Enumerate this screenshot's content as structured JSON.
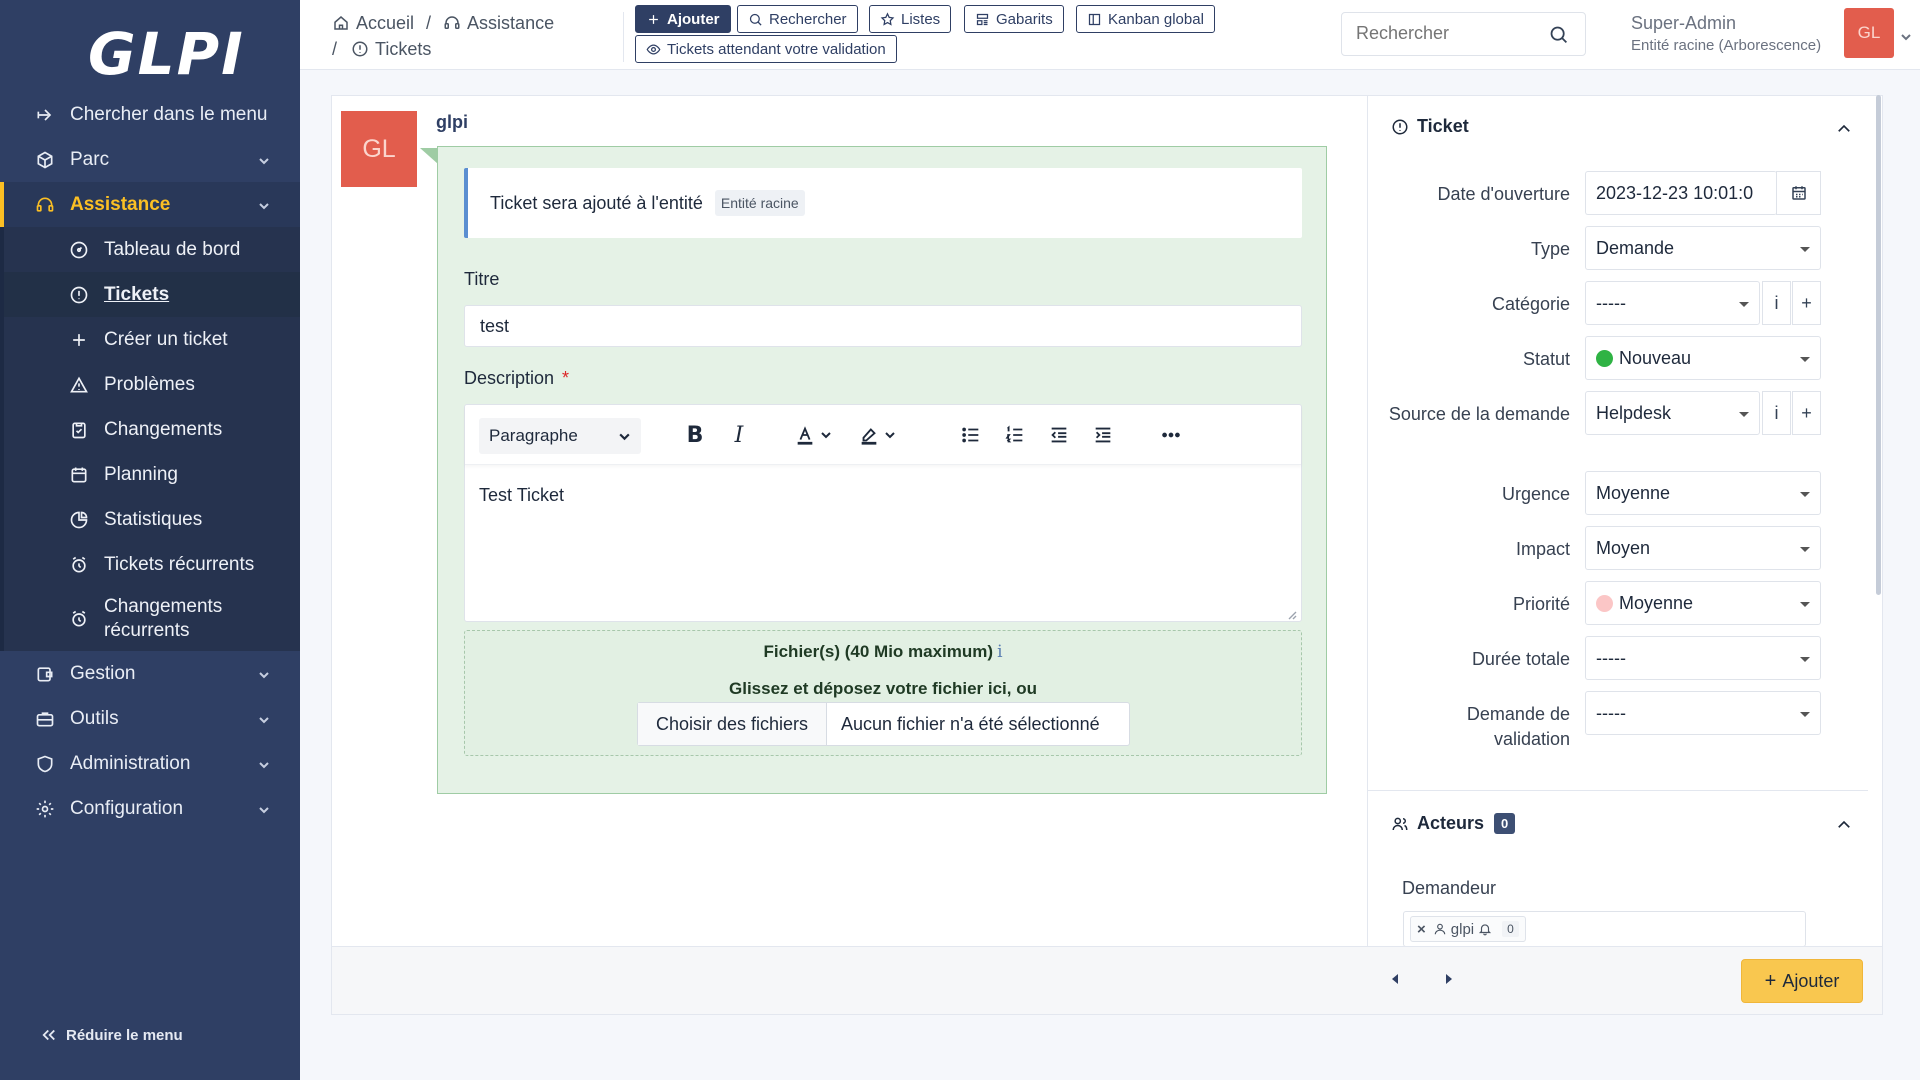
{
  "app": {
    "logo": "GLPI"
  },
  "sidebar": {
    "search_menu": "Chercher dans le menu",
    "items": [
      {
        "label": "Parc"
      },
      {
        "label": "Assistance"
      },
      {
        "label": "Gestion"
      },
      {
        "label": "Outils"
      },
      {
        "label": "Administration"
      },
      {
        "label": "Configuration"
      }
    ],
    "submenu": [
      {
        "label": "Tableau de bord"
      },
      {
        "label": "Tickets"
      },
      {
        "label": "Créer un ticket"
      },
      {
        "label": "Problèmes"
      },
      {
        "label": "Changements"
      },
      {
        "label": "Planning"
      },
      {
        "label": "Statistiques"
      },
      {
        "label": "Tickets récurrents"
      },
      {
        "label": "Changements récurrents"
      }
    ],
    "reduce": "Réduire le menu"
  },
  "header": {
    "breadcrumb": {
      "home": "Accueil",
      "section": "Assistance",
      "page": "Tickets"
    },
    "buttons": {
      "add": "Ajouter",
      "search": "Rechercher",
      "lists": "Listes",
      "templates": "Gabarits",
      "kanban": "Kanban global",
      "validation": "Tickets attendant votre validation"
    },
    "search_placeholder": "Rechercher",
    "user": {
      "name": "Super-Admin",
      "entity": "Entité racine (Arborescence)",
      "initials": "GL"
    }
  },
  "form": {
    "author": "glpi",
    "avatar_initials": "GL",
    "notice": "Ticket sera ajouté à l'entité",
    "notice_entity": "Entité racine",
    "title_label": "Titre",
    "title_value": "test",
    "description_label": "Description",
    "required_mark": "*",
    "paragraph_format": "Paragraphe",
    "description_value": "Test Ticket",
    "files_label": "Fichier(s) (40 Mio maximum)",
    "files_info": "i",
    "drop_text": "Glissez et déposez votre fichier ici, ou",
    "choose_files": "Choisir des fichiers",
    "no_file": "Aucun fichier n'a été sélectionné"
  },
  "ticket_panel": {
    "title": "Ticket",
    "fields": [
      {
        "label": "Date d'ouverture",
        "value": "2023-12-23 10:01:0"
      },
      {
        "label": "Type",
        "value": "Demande"
      },
      {
        "label": "Catégorie",
        "value": "-----"
      },
      {
        "label": "Statut",
        "value": "Nouveau",
        "dot_color": "#2fb344"
      },
      {
        "label": "Source de la demande",
        "value": "Helpdesk"
      },
      {
        "label": "Urgence",
        "value": "Moyenne"
      },
      {
        "label": "Impact",
        "value": "Moyen"
      },
      {
        "label": "Priorité",
        "value": "Moyenne",
        "dot_color": "#fbc6c6"
      },
      {
        "label": "Durée totale",
        "value": "-----"
      },
      {
        "label": "Demande de validation",
        "value": "-----"
      }
    ],
    "info_symbol": "i",
    "plus_symbol": "+"
  },
  "actors_panel": {
    "title": "Acteurs",
    "count": "0",
    "requester_label": "Demandeur",
    "requester_tag": "glpi",
    "requester_count": "0",
    "remove_symbol": "×"
  },
  "footer": {
    "add_label": "Ajouter"
  },
  "colors": {
    "sidebar": "#2f3f64",
    "accent": "#fbbf24",
    "form_bg": "#e5f2e6",
    "avatar": "#e25d4d"
  }
}
